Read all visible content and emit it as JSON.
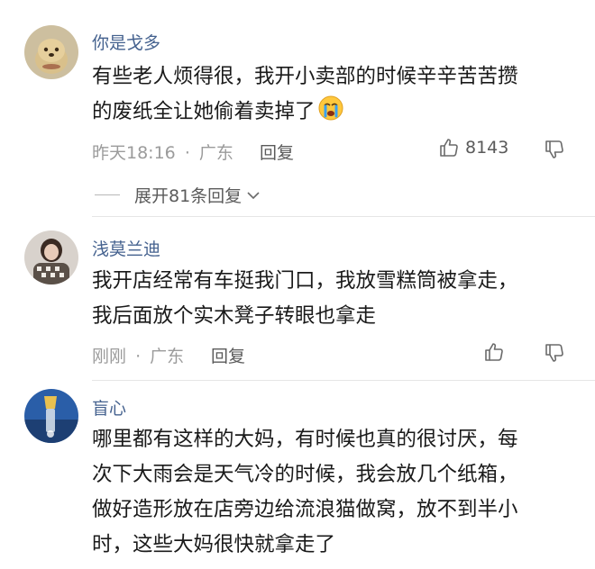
{
  "comments": [
    {
      "username": "你是戈多",
      "lines": [
        "有些老人烦得很，我开小卖部的时候辛辛苦苦攒",
        "的废纸全让她偷着卖掉了"
      ],
      "emoji_icon": "crying-face-icon",
      "time": "昨天18:16",
      "location": "广东",
      "reply_label": "回复",
      "like_count": "8143",
      "expand_label": "展开81条回复"
    },
    {
      "username": "浅莫兰迪",
      "lines": [
        "我开店经常有车挺我门口，我放雪糕筒被拿走，",
        "我后面放个实木凳子转眼也拿走"
      ],
      "time": "刚刚",
      "location": "广东",
      "reply_label": "回复"
    },
    {
      "username": "盲心",
      "lines": [
        "哪里都有这样的大妈，有时候也真的很讨厌，每",
        "次下大雨会是天气冷的时候，我会放几个纸箱，",
        "做好造形放在店旁边给流浪猫做窝，放不到半小",
        "时，这些大妈很快就拿走了"
      ]
    }
  ],
  "meta_separator": "·",
  "colors": {
    "username": "#45628f",
    "text": "#1a1a1a",
    "meta": "#9b9b9b",
    "action": "#5a5a5a"
  }
}
